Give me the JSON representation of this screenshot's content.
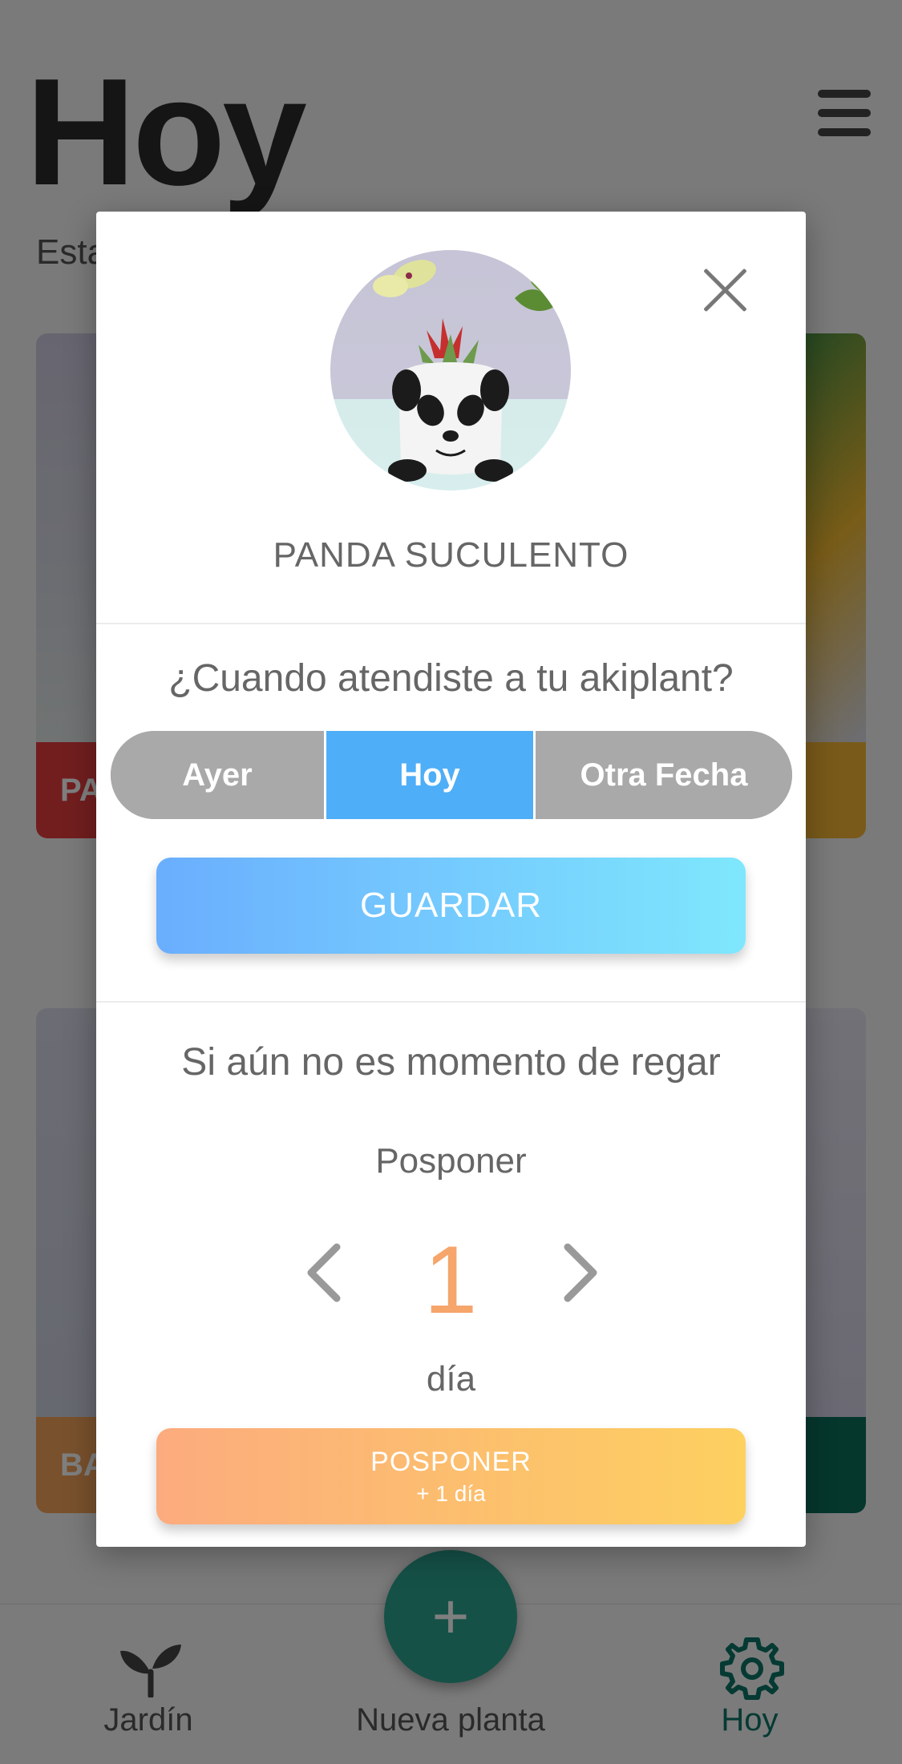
{
  "header": {
    "title": "Hoy",
    "subtitle": "Esta"
  },
  "cards": [
    {
      "label": "PA",
      "color": "#e53d3f"
    },
    {
      "label": "",
      "color": "#f2b535"
    },
    {
      "label": "BA",
      "color": "#f2a25a"
    },
    {
      "label": "",
      "color": "#0a6f5a"
    }
  ],
  "bottom_nav": {
    "items": [
      {
        "label": "Jardín",
        "icon": "sprout-icon"
      },
      {
        "label": "Nueva planta",
        "icon": "plus-icon"
      },
      {
        "label": "Hoy",
        "icon": "gear-icon",
        "active": true
      }
    ],
    "fab_symbol": "+"
  },
  "modal": {
    "plant_name": "PANDA SUCULENTO",
    "question": "¿Cuando atendiste a tu akiplant?",
    "options": [
      "Ayer",
      "Hoy",
      "Otra Fecha"
    ],
    "selected_option": "Hoy",
    "save_label": "GUARDAR",
    "hint": "Si aún no es momento de regar",
    "postpone_title": "Posponer",
    "postpone_value": "1",
    "postpone_unit": "día",
    "postpone_button": {
      "line1": "POSPONER",
      "line2": "+ 1 día"
    }
  },
  "colors": {
    "accent_blue": "#4eaef7",
    "accent_orange": "#f6a56b",
    "brand_green": "#0b7566"
  }
}
